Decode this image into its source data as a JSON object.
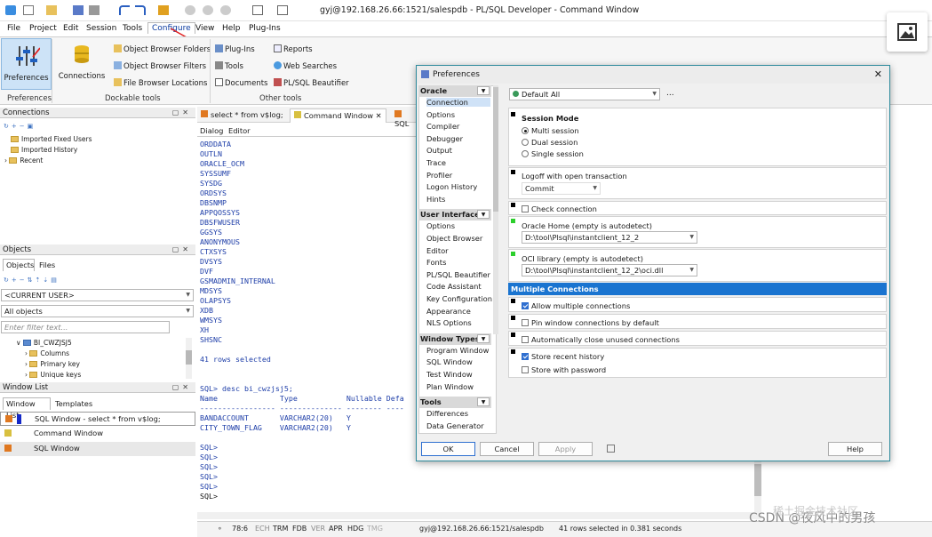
{
  "window_title": "gyj@192.168.26.66:1521/salespdb - PL/SQL Developer - Command Window",
  "menu": [
    "File",
    "Project",
    "Edit",
    "Session",
    "Tools",
    "Configure",
    "View",
    "Help",
    "Plug-Ins"
  ],
  "menu_active": "Configure",
  "ribbon": {
    "preferences": "Preferences",
    "connections": "Connections",
    "object_browser_folders": "Object Browser Folders",
    "object_browser_filters": "Object Browser Filters",
    "file_browser_locations": "File Browser Locations",
    "plugins": "Plug-Ins",
    "tools": "Tools",
    "documents": "Documents",
    "reports": "Reports",
    "web_searches": "Web Searches",
    "beautifier": "PL/SQL Beautifier",
    "group_preferences": "Preferences",
    "group_dockable": "Dockable tools",
    "group_other": "Other tools"
  },
  "connections_panel": {
    "title": "Connections",
    "items": [
      "Imported Fixed Users",
      "Imported History",
      "Recent"
    ]
  },
  "objects_panel": {
    "title": "Objects",
    "tabs": [
      "Objects",
      "Files"
    ],
    "current_user": "<CURRENT USER>",
    "all_objects": "All objects",
    "filter_placeholder": "Enter filter text...",
    "tree": [
      "BI_CWZJSJ5",
      "Columns",
      "Primary key",
      "Unique keys"
    ]
  },
  "window_list_panel": {
    "title": "Window List",
    "tabs": [
      "Window List",
      "Templates"
    ],
    "items": [
      "SQL Window - select * from v$log;",
      "Command Window",
      "SQL Window"
    ]
  },
  "editor_tabs": [
    "select * from v$log;",
    "Command Window",
    "SQL"
  ],
  "editor_subtabs": [
    "Dialog",
    "Editor"
  ],
  "output_lines": [
    "ORDDATA",
    "OUTLN",
    "ORACLE_OCM",
    "SYSSUMF",
    "SYSDG",
    "ORDSYS",
    "DBSNMP",
    "APPQOSSYS",
    "DBSFWUSER",
    "GGSYS",
    "ANONYMOUS",
    "CTXSYS",
    "DVSYS",
    "DVF",
    "GSMADMIN_INTERNAL",
    "MDSYS",
    "OLAPSYS",
    "XDB",
    "WMSYS",
    "XH",
    "SHSNC"
  ],
  "rows_selected": "41 rows selected",
  "desc_cmd": "SQL> desc bi_cwzjsj5;",
  "desc_header": "Name              Type           Nullable Defa",
  "desc_rule": "----------------- -------------- -------- ----",
  "desc_rows": [
    "BANDACCOUNT       VARCHAR2(20)   Y",
    "CITY_TOWN_FLAG    VARCHAR2(20)   Y"
  ],
  "prompts": [
    "SQL>",
    "SQL>",
    "SQL>",
    "SQL>",
    "SQL>",
    "SQL>"
  ],
  "status": {
    "pos": "78:6",
    "flags": [
      "ECH",
      "TRM",
      "FDB",
      "VER",
      "APR",
      "HDG",
      "TMG"
    ],
    "conn": "gyj@192.168.26.66:1521/salespdb",
    "msg": "41 rows selected in 0.381 seconds"
  },
  "watermark": "CSDN @夜风中的男孩",
  "watermark2": "稀土掘金技术社区",
  "dialog": {
    "title": "Preferences",
    "profile": "Default All",
    "profile_btn": "...",
    "oracle_head": "Oracle",
    "oracle_items": [
      "Connection",
      "Options",
      "Compiler",
      "Debugger",
      "Output",
      "Trace",
      "Profiler",
      "Logon History",
      "Hints"
    ],
    "ui_head": "User Interface",
    "ui_items": [
      "Options",
      "Object Browser",
      "Editor",
      "Fonts",
      "PL/SQL Beautifier",
      "Code Assistant",
      "Key Configuration",
      "Appearance",
      "NLS Options"
    ],
    "wt_head": "Window Types",
    "wt_items": [
      "Program Window",
      "SQL Window",
      "Test Window",
      "Plan Window"
    ],
    "tools_head": "Tools",
    "tools_items": [
      "Differences",
      "Data Generator"
    ],
    "session_mode": "Session Mode",
    "modes": [
      "Multi session",
      "Dual session",
      "Single session"
    ],
    "logoff_label": "Logoff with open transaction",
    "logoff_value": "Commit",
    "check_conn": "Check connection",
    "oracle_home_label": "Oracle Home (empty is autodetect)",
    "oracle_home_value": "D:\\tool\\Plsql\\instantclient_12_2",
    "oci_label": "OCI library (empty is autodetect)",
    "oci_value": "D:\\tool\\Plsql\\instantclient_12_2\\oci.dll",
    "multi_head": "Multiple Connections",
    "allow_multi": "Allow multiple connections",
    "pin_window": "Pin window connections by default",
    "auto_close": "Automatically close unused connections",
    "store_history": "Store recent history",
    "store_password": "Store with password",
    "ok": "OK",
    "cancel": "Cancel",
    "apply": "Apply",
    "help": "Help"
  }
}
